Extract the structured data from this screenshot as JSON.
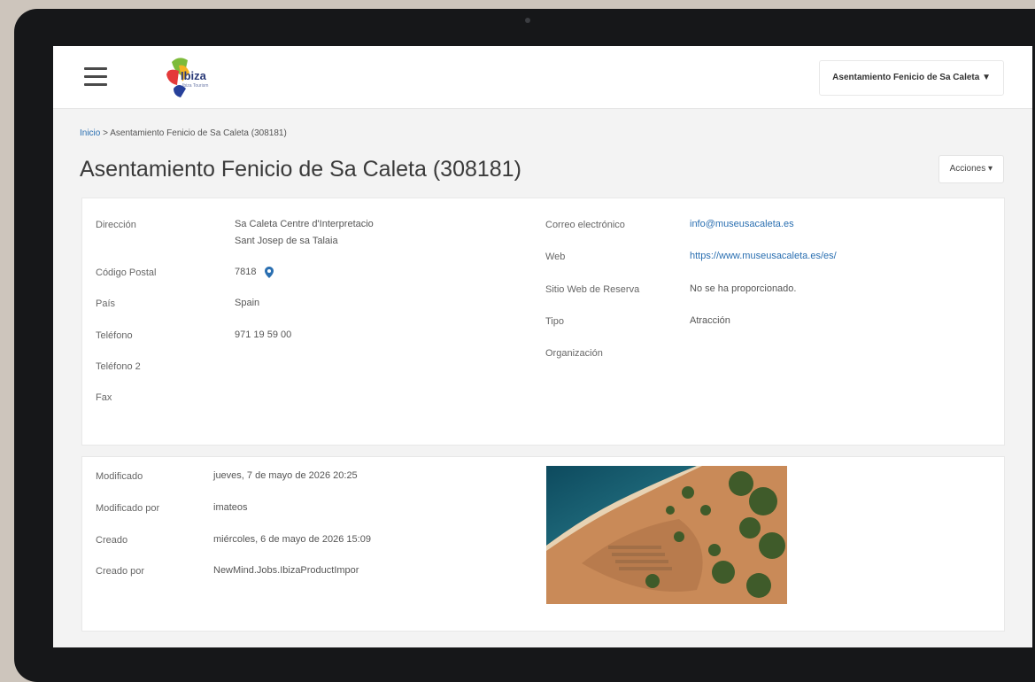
{
  "header": {
    "logo_text": "Ibiza",
    "logo_subtext": "Ibiza Tourism",
    "site_selector": "Asentamiento Fenicio de Sa Caleta ▼"
  },
  "breadcrumb": {
    "home": "Inicio",
    "separator": ">",
    "current": "Asentamiento Fenicio de Sa Caleta (308181)"
  },
  "page": {
    "title": "Asentamiento Fenicio de Sa Caleta (308181)",
    "actions_label": "Acciones ▾"
  },
  "details_left": [
    {
      "label": "Dirección",
      "value_line1": "Sa Caleta Centre d'Interpretacio",
      "value_line2": "Sant Josep de sa Talaia"
    },
    {
      "label": "Código Postal",
      "value": "7818"
    },
    {
      "label": "País",
      "value": "Spain"
    },
    {
      "label": "Teléfono",
      "value": "971 19 59 00"
    },
    {
      "label": "Teléfono 2",
      "value": ""
    },
    {
      "label": "Fax",
      "value": ""
    }
  ],
  "details_right": [
    {
      "label": "Correo electrónico",
      "value": "info@museusacaleta.es"
    },
    {
      "label": "Web",
      "value": "https://www.museusacaleta.es/es/"
    },
    {
      "label": "Sitio Web de Reserva",
      "value": "No se ha proporcionado."
    },
    {
      "label": "Tipo",
      "value": "Atracción"
    },
    {
      "label": "Organización",
      "value": ""
    }
  ],
  "meta": [
    {
      "label": "Modificado",
      "value": "jueves, 7 de mayo de 2026 20:25"
    },
    {
      "label": "Modificado por",
      "value": "imateos"
    },
    {
      "label": "Creado",
      "value": "miércoles, 6 de mayo de 2026 15:09"
    },
    {
      "label": "Creado por",
      "value": "NewMind.Jobs.IbizaProductImpor"
    }
  ],
  "colors": {
    "link": "#2a6fb1",
    "page_bg": "#f3f3f3",
    "bezel": "#161719"
  }
}
